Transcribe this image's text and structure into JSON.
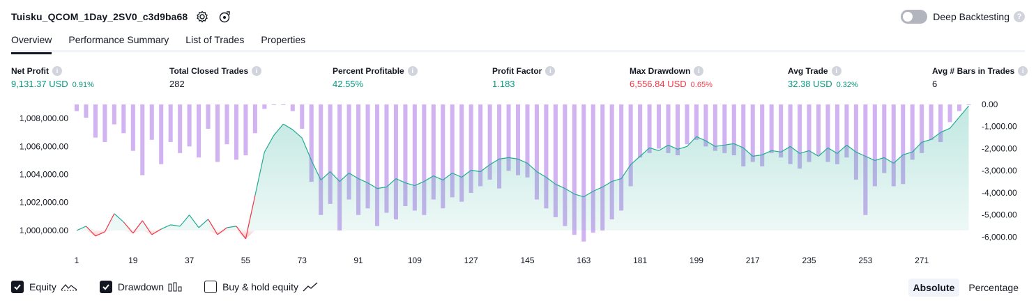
{
  "header": {
    "strategy_name": "Tuisku_QCOM_1Day_2SV0_c3d9ba68",
    "settings_icon": "gear-icon",
    "source_icon": "strategy-source-icon",
    "deep_backtesting_label": "Deep Backtesting",
    "deep_backtesting_on": false
  },
  "tabs": [
    {
      "label": "Overview",
      "active": true
    },
    {
      "label": "Performance Summary",
      "active": false
    },
    {
      "label": "List of Trades",
      "active": false
    },
    {
      "label": "Properties",
      "active": false
    }
  ],
  "metrics": {
    "net_profit": {
      "label": "Net Profit",
      "value": "9,131.37 USD",
      "pct": "0.91%"
    },
    "total_closed_trades": {
      "label": "Total Closed Trades",
      "value": "282"
    },
    "percent_profitable": {
      "label": "Percent Profitable",
      "value": "42.55%"
    },
    "profit_factor": {
      "label": "Profit Factor",
      "value": "1.183"
    },
    "max_drawdown": {
      "label": "Max Drawdown",
      "value": "6,556.84 USD",
      "pct": "0.65%"
    },
    "avg_trade": {
      "label": "Avg Trade",
      "value": "32.38 USD",
      "pct": "0.32%"
    },
    "avg_bars": {
      "label": "Avg # Bars in Trades",
      "value": "6"
    }
  },
  "colors": {
    "positive": "#089981",
    "negative": "#f23645",
    "drawdown_bar": "#c9a6f0",
    "equity_line_pos": "#22ab94",
    "equity_line_neg": "#f23645"
  },
  "legend": {
    "equity_label": "Equity",
    "equity_checked": true,
    "drawdown_label": "Drawdown",
    "drawdown_checked": true,
    "buyhold_label": "Buy & hold equity",
    "buyhold_checked": false
  },
  "mode": {
    "absolute_label": "Absolute",
    "percentage_label": "Percentage",
    "active": "Absolute"
  },
  "chart_data": {
    "type": "line",
    "x_ticks": [
      "1",
      "19",
      "37",
      "55",
      "73",
      "91",
      "109",
      "127",
      "145",
      "163",
      "181",
      "199",
      "217",
      "235",
      "253",
      "271"
    ],
    "y_left_ticks": [
      "1,008,000.00",
      "1,006,000.00",
      "1,004,000.00",
      "1,002,000.00",
      "1,000,000.00"
    ],
    "y_right_ticks": [
      "0.00",
      "-1,000.00",
      "-2,000.00",
      "-3,000.00",
      "-4,000.00",
      "-5,000.00",
      "-6,000.00"
    ],
    "x_range": [
      1,
      287
    ],
    "equity_ylim": [
      999000,
      1009000
    ],
    "drawdown_ylim": [
      -6300,
      0
    ],
    "equity_baseline": 1000000,
    "series": [
      {
        "name": "Equity",
        "x": [
          1,
          4,
          7,
          10,
          13,
          16,
          19,
          22,
          25,
          28,
          31,
          34,
          37,
          40,
          43,
          46,
          49,
          52,
          55,
          58,
          61,
          64,
          67,
          70,
          73,
          76,
          79,
          82,
          85,
          88,
          91,
          94,
          97,
          100,
          103,
          106,
          109,
          112,
          115,
          118,
          121,
          124,
          127,
          130,
          133,
          136,
          139,
          142,
          145,
          148,
          151,
          154,
          157,
          160,
          163,
          166,
          169,
          172,
          175,
          178,
          181,
          184,
          187,
          190,
          193,
          196,
          199,
          202,
          205,
          208,
          211,
          214,
          217,
          220,
          223,
          226,
          229,
          232,
          235,
          238,
          241,
          244,
          247,
          250,
          253,
          256,
          259,
          262,
          265,
          268,
          271,
          274,
          277,
          280,
          283,
          286
        ],
        "values": [
          1000000,
          1000300,
          999600,
          999900,
          1001200,
          1000600,
          999800,
          1000700,
          999700,
          1000100,
          1000400,
          1000300,
          1001100,
          1000200,
          1000800,
          999700,
          1000200,
          1000300,
          999400,
          1002500,
          1005600,
          1006800,
          1007600,
          1007200,
          1006600,
          1005000,
          1003600,
          1004200,
          1003500,
          1004100,
          1003700,
          1003400,
          1003000,
          1003100,
          1003700,
          1003400,
          1003200,
          1003500,
          1003900,
          1003600,
          1004100,
          1003800,
          1004300,
          1004200,
          1004700,
          1005100,
          1005200,
          1005100,
          1004800,
          1004200,
          1003800,
          1003300,
          1003000,
          1002600,
          1002400,
          1002800,
          1003100,
          1003500,
          1003700,
          1004700,
          1005300,
          1005900,
          1005700,
          1006100,
          1005800,
          1006000,
          1006700,
          1006400,
          1006000,
          1006100,
          1006200,
          1005900,
          1005300,
          1005400,
          1005700,
          1005600,
          1006000,
          1005500,
          1005700,
          1005300,
          1005900,
          1005500,
          1006100,
          1005600,
          1005300,
          1005000,
          1005200,
          1004800,
          1005400,
          1005600,
          1006300,
          1006500,
          1007000,
          1007300,
          1008100,
          1008900
        ]
      },
      {
        "name": "Drawdown",
        "x": [
          1,
          4,
          7,
          10,
          13,
          16,
          19,
          22,
          25,
          28,
          31,
          34,
          37,
          40,
          43,
          46,
          49,
          52,
          55,
          58,
          61,
          64,
          67,
          70,
          73,
          76,
          79,
          82,
          85,
          88,
          91,
          94,
          97,
          100,
          103,
          106,
          109,
          112,
          115,
          118,
          121,
          124,
          127,
          130,
          133,
          136,
          139,
          142,
          145,
          148,
          151,
          154,
          157,
          160,
          163,
          166,
          169,
          172,
          175,
          178,
          181,
          184,
          187,
          190,
          193,
          196,
          199,
          202,
          205,
          208,
          211,
          214,
          217,
          220,
          223,
          226,
          229,
          232,
          235,
          238,
          241,
          244,
          247,
          250,
          253,
          256,
          259,
          262,
          265,
          268,
          271,
          274,
          277,
          280,
          283,
          286
        ],
        "values": [
          -300,
          -600,
          -1500,
          -1700,
          -900,
          -1300,
          -2100,
          -3200,
          -1600,
          -2700,
          -1700,
          -2200,
          -1900,
          -2400,
          -1100,
          -2600,
          -1800,
          -2500,
          -2300,
          -1300,
          -200,
          0,
          0,
          -300,
          -1100,
          -3500,
          -5000,
          -4500,
          -5700,
          -4300,
          -5000,
          -4700,
          -5500,
          -4900,
          -5200,
          -4600,
          -4800,
          -5000,
          -4300,
          -4700,
          -4200,
          -4400,
          -4000,
          -3700,
          -3400,
          -3800,
          -3000,
          -3200,
          -3300,
          -4300,
          -4700,
          -5100,
          -5500,
          -5900,
          -6200,
          -5800,
          -5700,
          -5200,
          -4800,
          -3700,
          -2400,
          -2200,
          -2000,
          -2200,
          -2300,
          -1800,
          -1600,
          -1900,
          -2100,
          -2200,
          -2300,
          -2800,
          -2600,
          -2800,
          -2200,
          -2400,
          -2700,
          -2900,
          -2600,
          -2300,
          -2600,
          -2700,
          -2400,
          -3400,
          -5000,
          -3700,
          -3100,
          -3700,
          -3600,
          -2500,
          -2200,
          -1600,
          -1700,
          -800,
          -300,
          0
        ]
      }
    ]
  }
}
